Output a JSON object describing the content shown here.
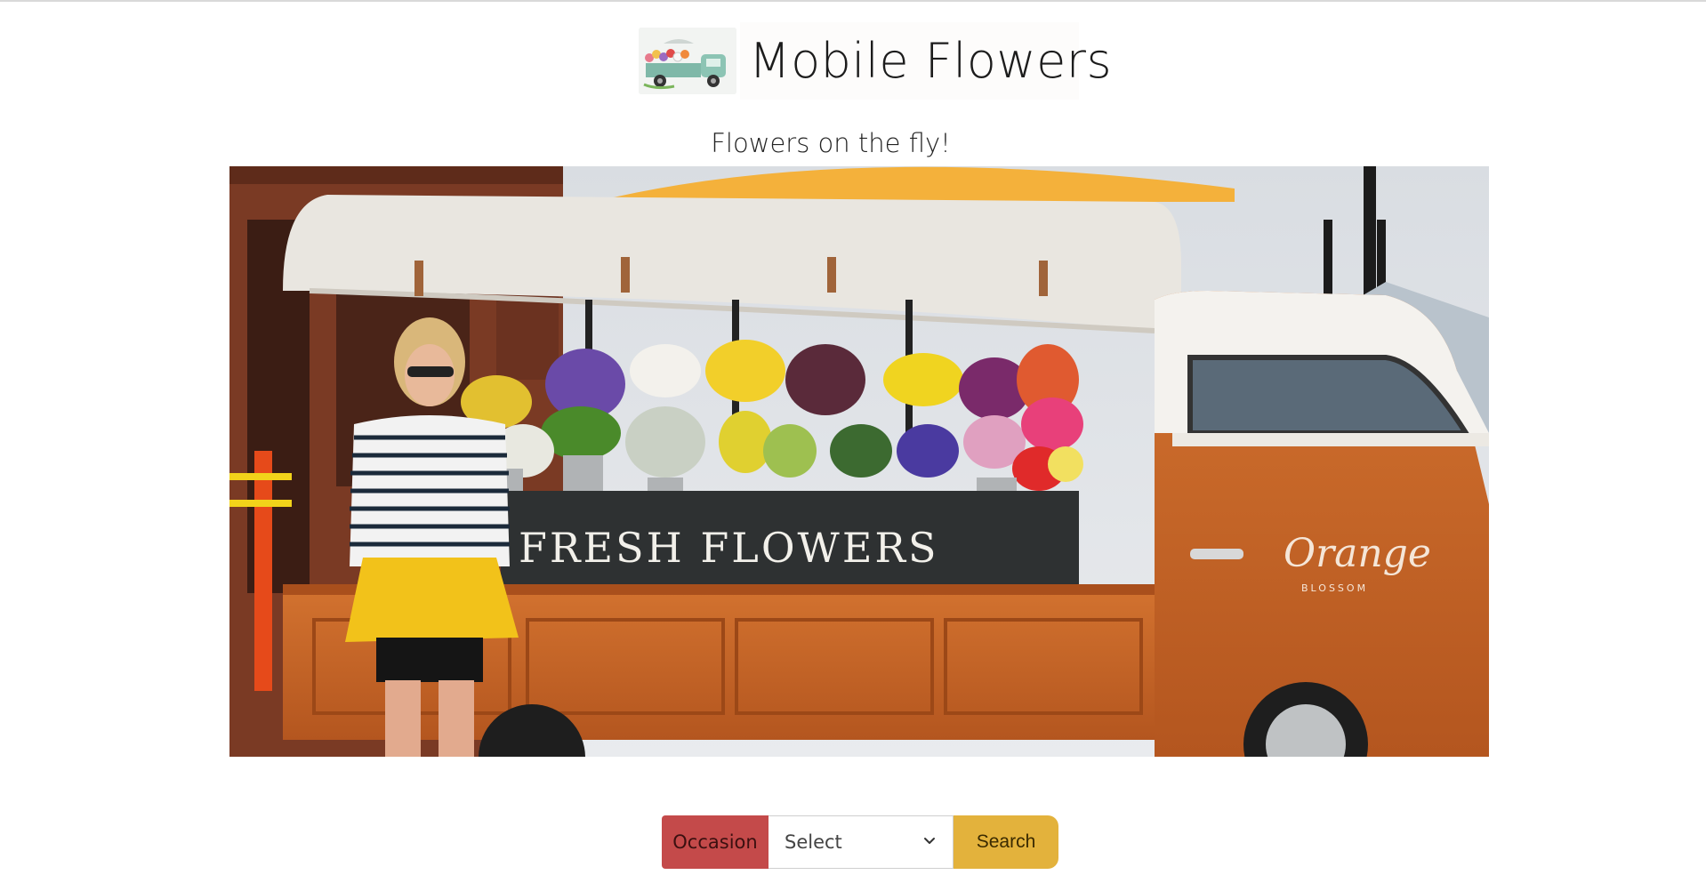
{
  "header": {
    "title": "Mobile Flowers",
    "logo_icon": "flower-truck-logo-icon"
  },
  "tagline": "Flowers on the fly!",
  "hero": {
    "sign_text": "FRESH FLOWERS",
    "truck_brand_script": "Orange",
    "truck_brand_small": "BLOSSOM"
  },
  "search": {
    "label": "Occasion",
    "select_value": "Select",
    "button_label": "Search"
  },
  "colors": {
    "occasion_bg": "#c44a4a",
    "search_bg": "#e3b23c",
    "truck_orange": "#c8642a",
    "umbrella": "#f4b13b"
  }
}
